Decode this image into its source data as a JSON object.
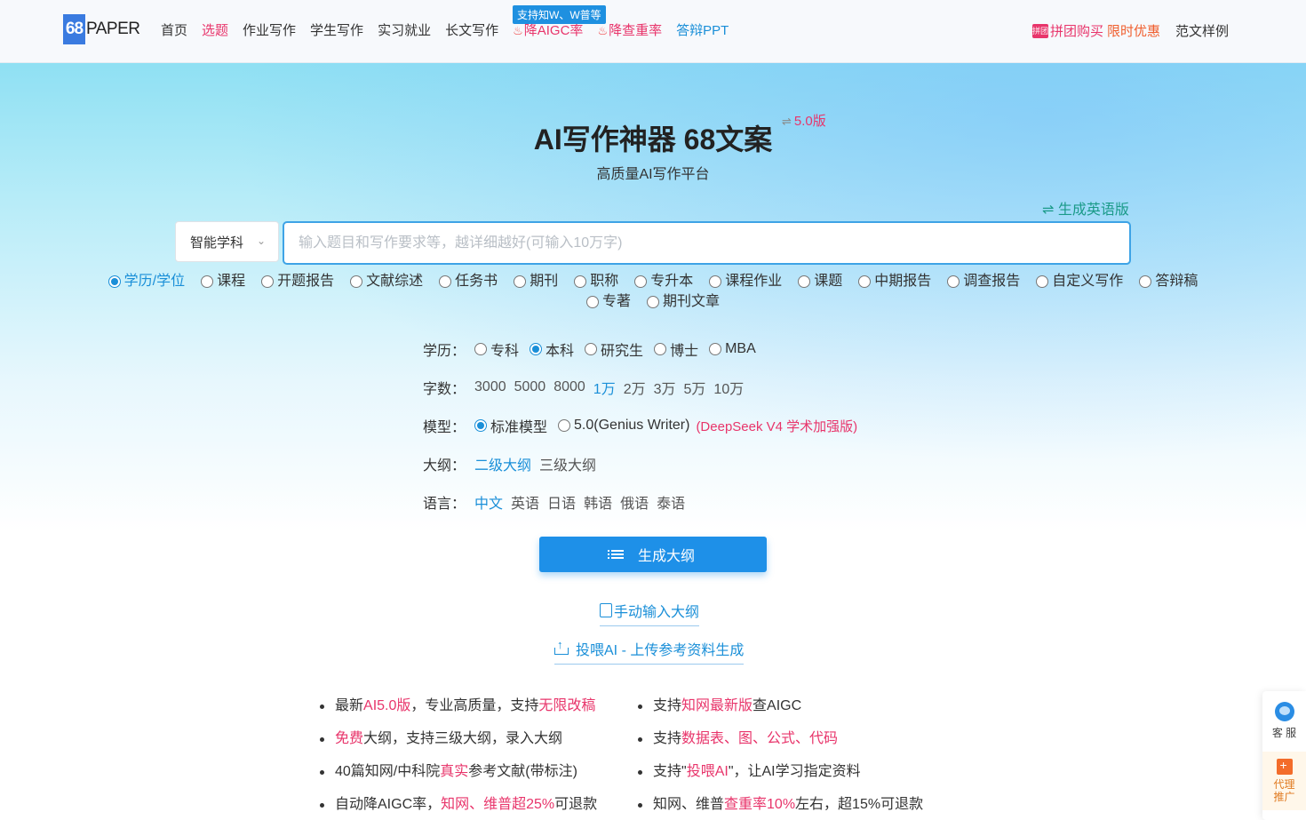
{
  "header": {
    "logo": {
      "mark": "68",
      "text": "PAPER"
    },
    "nav": [
      {
        "label": "首页",
        "style": "normal"
      },
      {
        "label": "选题",
        "style": "pink"
      },
      {
        "label": "作业写作",
        "style": "normal"
      },
      {
        "label": "学生写作",
        "style": "normal"
      },
      {
        "label": "实习就业",
        "style": "normal"
      },
      {
        "label": "长文写作",
        "style": "normal"
      },
      {
        "label": "降AIGC率",
        "style": "red",
        "icon": "flame-icon"
      },
      {
        "label": "降查重率",
        "style": "red",
        "icon": "flame-icon"
      },
      {
        "label": "答辩PPT",
        "style": "blue"
      }
    ],
    "nav_tip": "支持知W、W普等",
    "promo": {
      "tag": "拼团",
      "label": "拼团购买",
      "deal": "限时优惠"
    },
    "samples": "范文样例"
  },
  "hero": {
    "title": "AI写作神器 68文案",
    "version_symbol": "⇌",
    "version": "5.0版",
    "subtitle": "高质量AI写作平台",
    "english_link": "⇌ 生成英语版"
  },
  "search": {
    "subject": "智能学科",
    "placeholder": "输入题目和写作要求等，越详细越好(可输入10万字)",
    "value": ""
  },
  "types": [
    {
      "label": "学历/学位",
      "checked": true
    },
    {
      "label": "课程",
      "checked": false
    },
    {
      "label": "开题报告",
      "checked": false
    },
    {
      "label": "文献综述",
      "checked": false
    },
    {
      "label": "任务书",
      "checked": false
    },
    {
      "label": "期刊",
      "checked": false
    },
    {
      "label": "职称",
      "checked": false
    },
    {
      "label": "专升本",
      "checked": false
    },
    {
      "label": "课程作业",
      "checked": false
    },
    {
      "label": "课题",
      "checked": false
    },
    {
      "label": "中期报告",
      "checked": false
    },
    {
      "label": "调查报告",
      "checked": false
    },
    {
      "label": "自定义写作",
      "checked": false
    },
    {
      "label": "答辩稿",
      "checked": false
    },
    {
      "label": "专著",
      "checked": false
    },
    {
      "label": "期刊文章",
      "checked": false
    }
  ],
  "options": {
    "degree": {
      "label": "学历：",
      "items": [
        "专科",
        "本科",
        "研究生",
        "博士",
        "MBA"
      ],
      "selected": "本科"
    },
    "words": {
      "label": "字数：",
      "items": [
        "3000",
        "5000",
        "8000",
        "1万",
        "2万",
        "3万",
        "5万",
        "10万"
      ],
      "selected": "1万"
    },
    "model": {
      "label": "模型：",
      "items": [
        "标准模型",
        "5.0(Genius Writer)"
      ],
      "selected": "标准模型",
      "note": "(DeepSeek V4 学术加强版)"
    },
    "outline": {
      "label": "大纲：",
      "items": [
        "二级大纲",
        "三级大纲"
      ],
      "selected": "二级大纲"
    },
    "language": {
      "label": "语言：",
      "items": [
        "中文",
        "英语",
        "日语",
        "韩语",
        "俄语",
        "泰语"
      ],
      "selected": "中文"
    }
  },
  "actions": {
    "generate": "生成大纲",
    "manual": "手动输入大纲",
    "upload": "投喂AI - 上传参考资料生成"
  },
  "features_left": [
    [
      [
        "最新",
        ""
      ],
      [
        "AI5.0版",
        "hl"
      ],
      [
        "，专业高质量，支持",
        ""
      ],
      [
        "无限改稿",
        "hl"
      ]
    ],
    [
      [
        "免费",
        "hl"
      ],
      [
        "大纲，支持三级大纲，录入大纲",
        ""
      ]
    ],
    [
      [
        "40篇知网/中科院",
        ""
      ],
      [
        "真实",
        "hl"
      ],
      [
        "参考文献(带标注)",
        ""
      ]
    ],
    [
      [
        "自动降AIGC率，",
        ""
      ],
      [
        "知网、维普超25%",
        "hl"
      ],
      [
        "可退款",
        ""
      ]
    ]
  ],
  "features_right": [
    [
      [
        "支持",
        ""
      ],
      [
        "知网最新版",
        "hl"
      ],
      [
        "查AIGC",
        ""
      ]
    ],
    [
      [
        "支持",
        ""
      ],
      [
        "数据表、图、公式、代码",
        "hl"
      ]
    ],
    [
      [
        "支持\"",
        ""
      ],
      [
        "投喂AI",
        "hl"
      ],
      [
        "\"，让AI学习指定资料",
        ""
      ]
    ],
    [
      [
        "知网、维普",
        ""
      ],
      [
        "查重率10%",
        "hl"
      ],
      [
        "左右，超15%可退款",
        ""
      ]
    ]
  ],
  "float": {
    "service": "客 服",
    "agent": "代理推广"
  }
}
